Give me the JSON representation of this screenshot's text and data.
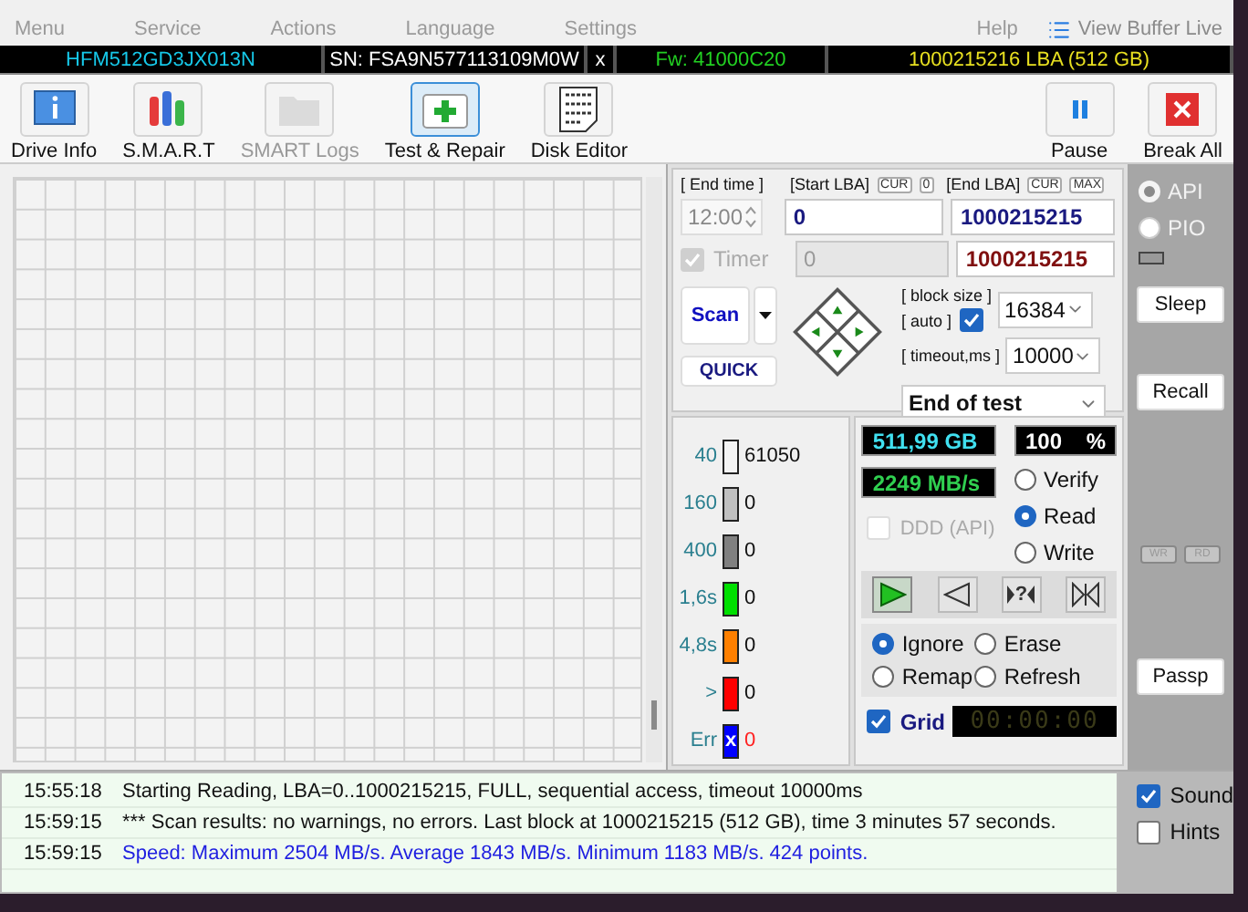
{
  "menu": [
    "Menu",
    "Service",
    "Actions",
    "Language",
    "Settings",
    "Help"
  ],
  "buffer_button": "View Buffer Live",
  "drive_bar": [
    {
      "kind": "model",
      "text": "HFM512GD3JX013N"
    },
    {
      "kind": "serial",
      "text": "SN: FSA9N577113109M0W"
    },
    {
      "kind": "close",
      "text": "x"
    },
    {
      "kind": "firmware",
      "text": "Fw: 41000C20"
    },
    {
      "kind": "capacity",
      "text": "1000215216 LBA (512 GB)"
    }
  ],
  "toolbar": [
    {
      "kind": "info",
      "label": "Drive Info",
      "selected": false,
      "disabled": false
    },
    {
      "kind": "smart",
      "label": "S.M.A.R.T",
      "selected": false,
      "disabled": false
    },
    {
      "kind": "logs",
      "label": "SMART Logs",
      "selected": false,
      "disabled": true
    },
    {
      "kind": "test",
      "label": "Test & Repair",
      "selected": true,
      "disabled": false
    },
    {
      "kind": "editor",
      "label": "Disk Editor",
      "selected": false,
      "disabled": false
    },
    {
      "kind": "pause",
      "label": "Pause",
      "selected": false,
      "disabled": false
    },
    {
      "kind": "break",
      "label": "Break All",
      "selected": false,
      "disabled": false
    }
  ],
  "scan": {
    "end_time_label": "[ End time ]",
    "start_lba_label": "[Start LBA]",
    "cur_start": "CUR",
    "cur_start_value": "0",
    "end_lba_label": "[End LBA]",
    "cur_end": "CUR",
    "max": "MAX",
    "end_time": "12:00",
    "start_lba": "0",
    "end_lba": "1000215215",
    "timer_label": "Timer",
    "timer_checked": true,
    "timer_disabled": true,
    "timer_value": "0",
    "end_lba_current": "1000215215",
    "scan_button": "Scan",
    "quick_button": "QUICK",
    "block_size_label": "[ block size ]",
    "auto_label": "[ auto ]",
    "auto_checked": true,
    "timeout_label": "[ timeout,ms ]",
    "block_size": "16384",
    "timeout": "10000",
    "end_action": "End of test"
  },
  "legend": [
    {
      "kind": "block",
      "label": "40",
      "color": "#f4f4f4",
      "count": "61050"
    },
    {
      "kind": "block",
      "label": "160",
      "color": "#c0c0c0",
      "count": "0"
    },
    {
      "kind": "block",
      "label": "400",
      "color": "#808080",
      "count": "0"
    },
    {
      "kind": "block",
      "label": "1,6s",
      "color": "#00e000",
      "count": "0"
    },
    {
      "kind": "block",
      "label": "4,8s",
      "color": "#ff8000",
      "count": "0"
    },
    {
      "kind": "block",
      "label": ">",
      "color": "#ff0000",
      "count": "0"
    },
    {
      "kind": "error",
      "label": "Err",
      "color": "#0000ff",
      "mark": "x",
      "count": "0"
    }
  ],
  "stats": {
    "capacity": "511,99 GB",
    "percent": "100",
    "percent_unit": "%",
    "speed": "2249 MB/s"
  },
  "modes": [
    {
      "label": "Verify",
      "selected": false
    },
    {
      "label": "Read",
      "selected": true
    },
    {
      "label": "Write",
      "selected": false
    }
  ],
  "ddd": {
    "label": "DDD (API)",
    "checked": false,
    "disabled": true
  },
  "transport": [
    {
      "kind": "play",
      "selected": true
    },
    {
      "kind": "back",
      "selected": false
    },
    {
      "kind": "random",
      "label": "?",
      "selected": false
    },
    {
      "kind": "butterfly",
      "selected": false
    }
  ],
  "repair": [
    {
      "label": "Ignore",
      "selected": true
    },
    {
      "label": "Erase",
      "selected": false
    },
    {
      "label": "Remap",
      "selected": false
    },
    {
      "label": "Refresh",
      "selected": false
    }
  ],
  "grid": {
    "label": "Grid",
    "checked": true
  },
  "elapsed": "00:00:00",
  "side": {
    "interfaces": [
      {
        "label": "API",
        "selected": true,
        "disabled": true
      },
      {
        "label": "PIO",
        "selected": false,
        "disabled": true
      }
    ],
    "buttons": [
      "Sleep",
      "Recall",
      "Passp"
    ],
    "indicators": [
      "WR",
      "RD"
    ]
  },
  "log": [
    {
      "kind": "info",
      "time": "15:55:18",
      "text": "Starting Reading, LBA=0..1000215215, FULL, sequential access, timeout 10000ms"
    },
    {
      "kind": "info",
      "time": "15:59:15",
      "text": "*** Scan results: no warnings, no errors. Last block at 1000215215 (512 GB), time 3 minutes 57 seconds."
    },
    {
      "kind": "speed",
      "time": "15:59:15",
      "text": "Speed: Maximum 2504 MB/s. Average 1843 MB/s. Minimum 1183 MB/s. 424 points."
    }
  ],
  "options": [
    {
      "label": "Sound",
      "checked": true
    },
    {
      "label": "Hints",
      "checked": false
    }
  ]
}
